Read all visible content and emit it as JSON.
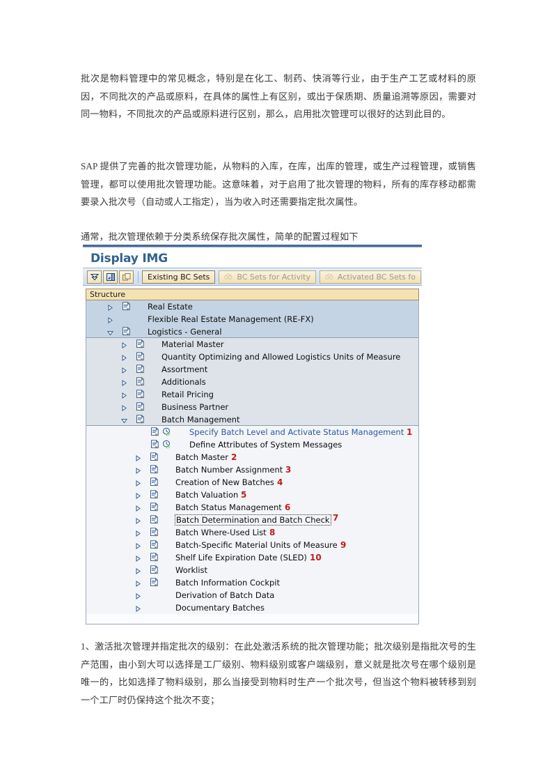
{
  "document": {
    "paragraphs": [
      "批次是物料管理中的常见概念，特别是在化工、制药、快消等行业，由于生产工艺或材料的原因，不同批次的产品或原料，在具体的属性上有区别，或出于保质期、质量追溯等原因，需要对同一物料，不同批次的产品或原料进行区别，那么，启用批次管理可以很好的达到此目的。",
      "SAP 提供了完善的批次管理功能，从物料的入库，在库，出库的管理，或生产过程管理，或销售管理，都可以使用批次管理功能。这意味着，对于启用了批次管理的物料，所有的库存移动都需要录入批次号（自动或人工指定），当为收入时还需要指定批次属性。",
      "通常，批次管理依赖于分类系统保存批次属性，简单的配置过程如下",
      "1、激活批次管理并指定批次的级别：在此处激活系统的批次管理功能；批次级别是指批次号的生产范围，由小到大可以选择是工厂级别、物料级别或客户端级别，意义就是批次号在哪个级别是唯一的，比如选择了物料级别，那么当接受到物料时生产一个批次号，但当这个物料被转移到别一个工厂时仍保持这个批次不变；"
    ]
  },
  "sap": {
    "title": "Display IMG",
    "toolbar": {
      "icons": [
        {
          "name": "collapse-all-icon",
          "glyph": "collapse"
        },
        {
          "name": "expand-node-icon",
          "glyph": "expand"
        },
        {
          "name": "copy-icon",
          "glyph": "copy"
        }
      ],
      "buttons": [
        {
          "label": "Existing BC Sets",
          "disabled": false,
          "icon": null
        },
        {
          "label": "BC Sets for Activity",
          "disabled": true,
          "icon": "bc-sets-icon"
        },
        {
          "label": "Activated BC Sets fo",
          "disabled": true,
          "icon": "bc-sets-icon"
        }
      ]
    },
    "column_header": "Structure",
    "tree": [
      {
        "label": "Real Estate",
        "level": 1,
        "arrow": "collapsed",
        "doc": true,
        "activity": false,
        "link": false,
        "annot": "",
        "selected": false
      },
      {
        "label": "Flexible Real Estate Management (RE-FX)",
        "level": 1,
        "arrow": "collapsed",
        "doc": false,
        "activity": false,
        "link": false,
        "annot": "",
        "selected": false
      },
      {
        "label": "Logistics - General",
        "level": 1,
        "arrow": "expanded",
        "doc": true,
        "activity": false,
        "link": false,
        "annot": "",
        "selected": false
      },
      {
        "label": "Material Master",
        "level": 2,
        "arrow": "collapsed",
        "doc": true,
        "activity": false,
        "link": false,
        "annot": "",
        "selected": false
      },
      {
        "label": "Quantity Optimizing and Allowed Logistics Units of Measure",
        "level": 2,
        "arrow": "collapsed",
        "doc": true,
        "activity": false,
        "link": false,
        "annot": "",
        "selected": false
      },
      {
        "label": "Assortment",
        "level": 2,
        "arrow": "collapsed",
        "doc": true,
        "activity": false,
        "link": false,
        "annot": "",
        "selected": false
      },
      {
        "label": "Additionals",
        "level": 2,
        "arrow": "collapsed",
        "doc": true,
        "activity": false,
        "link": false,
        "annot": "",
        "selected": false
      },
      {
        "label": "Retail Pricing",
        "level": 2,
        "arrow": "collapsed",
        "doc": true,
        "activity": false,
        "link": false,
        "annot": "",
        "selected": false
      },
      {
        "label": "Business Partner",
        "level": 2,
        "arrow": "collapsed",
        "doc": true,
        "activity": false,
        "link": false,
        "annot": "",
        "selected": false
      },
      {
        "label": "Batch Management",
        "level": 2,
        "arrow": "expanded",
        "doc": true,
        "activity": false,
        "link": false,
        "annot": "",
        "selected": false
      },
      {
        "label": "Specify Batch Level and Activate Status Management",
        "level": 3,
        "arrow": "none",
        "doc": true,
        "activity": true,
        "link": true,
        "annot": "1",
        "selected": false
      },
      {
        "label": "Define Attributes of System Messages",
        "level": 3,
        "arrow": "none",
        "doc": true,
        "activity": true,
        "link": false,
        "annot": "",
        "selected": false
      },
      {
        "label": "Batch Master",
        "level": 3,
        "arrow": "collapsed",
        "doc": true,
        "activity": false,
        "link": false,
        "annot": "2",
        "selected": false
      },
      {
        "label": "Batch Number Assignment",
        "level": 3,
        "arrow": "collapsed",
        "doc": true,
        "activity": false,
        "link": false,
        "annot": "3",
        "selected": false
      },
      {
        "label": "Creation of New Batches",
        "level": 3,
        "arrow": "collapsed",
        "doc": true,
        "activity": false,
        "link": false,
        "annot": "4",
        "selected": false
      },
      {
        "label": "Batch Valuation",
        "level": 3,
        "arrow": "collapsed",
        "doc": true,
        "activity": false,
        "link": false,
        "annot": "5",
        "selected": false
      },
      {
        "label": "Batch Status Management",
        "level": 3,
        "arrow": "collapsed",
        "doc": true,
        "activity": false,
        "link": false,
        "annot": "6",
        "selected": false
      },
      {
        "label": "Batch Determination and Batch Check",
        "level": 3,
        "arrow": "collapsed",
        "doc": true,
        "activity": false,
        "link": false,
        "annot": "7",
        "selected": true
      },
      {
        "label": "Batch Where-Used List",
        "level": 3,
        "arrow": "collapsed",
        "doc": true,
        "activity": false,
        "link": false,
        "annot": "8",
        "selected": false
      },
      {
        "label": "Batch-Specific Material Units of Measure",
        "level": 3,
        "arrow": "collapsed",
        "doc": true,
        "activity": false,
        "link": false,
        "annot": "9",
        "selected": false
      },
      {
        "label": "Shelf Life Expiration Date (SLED)",
        "level": 3,
        "arrow": "collapsed",
        "doc": true,
        "activity": false,
        "link": false,
        "annot": "10",
        "selected": false
      },
      {
        "label": "Worklist",
        "level": 3,
        "arrow": "collapsed",
        "doc": true,
        "activity": false,
        "link": false,
        "annot": "",
        "selected": false
      },
      {
        "label": "Batch Information Cockpit",
        "level": 3,
        "arrow": "collapsed",
        "doc": true,
        "activity": false,
        "link": false,
        "annot": "",
        "selected": false
      },
      {
        "label": "Derivation of Batch Data",
        "level": 3,
        "arrow": "collapsed",
        "doc": false,
        "activity": false,
        "link": false,
        "annot": "",
        "selected": false
      },
      {
        "label": "Documentary Batches",
        "level": 3,
        "arrow": "collapsed",
        "doc": false,
        "activity": false,
        "link": false,
        "annot": "",
        "selected": false
      }
    ],
    "colors": {
      "title": "#31618f",
      "link": "#2a5a9c",
      "annotation": "#c21b1b",
      "header_band": "#f4e2b4",
      "level1_band": "#c5d4e4",
      "level2_band": "#dde3e9"
    }
  }
}
